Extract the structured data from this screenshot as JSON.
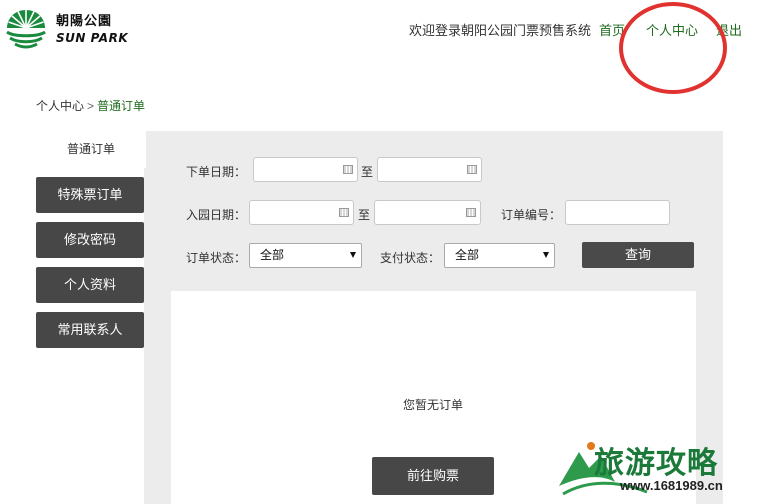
{
  "header": {
    "brand_cn": "朝陽公園",
    "brand_en": "SUN PARK",
    "welcome": "欢迎登录朝阳公园门票预售系统",
    "nav": {
      "home": "首页",
      "center": "个人中心",
      "logout": "退出"
    }
  },
  "breadcrumb": {
    "root": "个人中心",
    "separator": ">",
    "current": "普通订单"
  },
  "sidebar": {
    "active_tab": "普通订单",
    "items": [
      {
        "label": "特殊票订单"
      },
      {
        "label": "修改密码"
      },
      {
        "label": "个人资料"
      },
      {
        "label": "常用联系人"
      }
    ]
  },
  "filters": {
    "order_date_label": "下单日期：",
    "entry_date_label": "入园日期：",
    "range_to": "至",
    "order_no_label": "订单编号：",
    "order_status_label": "订单状态：",
    "order_status_value": "全部",
    "pay_status_label": "支付状态：",
    "pay_status_value": "全部",
    "query_button": "查询"
  },
  "results": {
    "empty_message": "您暂无订单",
    "buy_button": "前往购票"
  },
  "watermark": {
    "title": "旅游攻略",
    "url": "www.1681989.cn"
  },
  "colors": {
    "accent_green": "#1f6b1f",
    "dark_button": "#474747",
    "highlight_circle": "#e0322f",
    "panel_bg": "#ececec"
  }
}
